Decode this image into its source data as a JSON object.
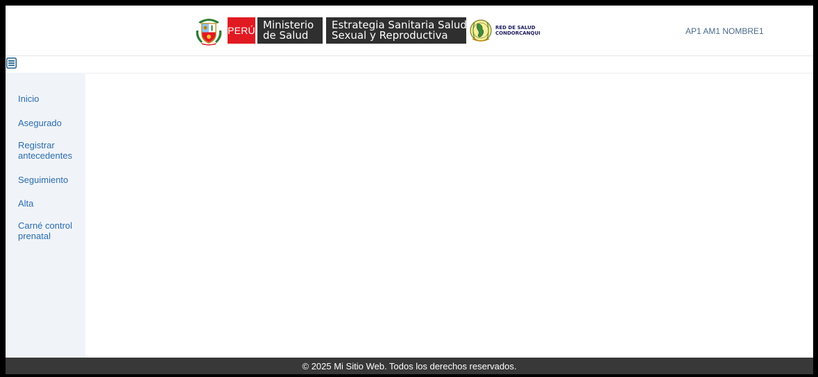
{
  "header": {
    "peru_label": "PERÚ",
    "ministerio_line1": "Ministerio",
    "ministerio_line2": "de Salud",
    "estrategia_line1": "Estrategia Sanitaria Salud",
    "estrategia_line2": "Sexual y Reproductiva",
    "red_line1": "RED DE SALUD",
    "red_line2": "CONDORCANQUI",
    "user_name": "AP1 AM1 NOMBRE1"
  },
  "toolbar": {
    "menu_icon": "hamburger-menu-icon"
  },
  "sidebar": {
    "items": [
      {
        "label": "Inicio"
      },
      {
        "label": "Asegurado"
      },
      {
        "label": "Registrar antecedentes"
      },
      {
        "label": "Seguimiento"
      },
      {
        "label": "Alta"
      },
      {
        "label": "Carné control prenatal"
      }
    ]
  },
  "footer": {
    "text": "© 2025 Mi Sitio Web. Todos los derechos reservados."
  },
  "colors": {
    "link": "#2b6cb0",
    "peru_red": "#e11a22",
    "header_dark": "#2f2f2f",
    "sidebar_bg": "#f0f4f9",
    "footer_bg": "#383838"
  }
}
